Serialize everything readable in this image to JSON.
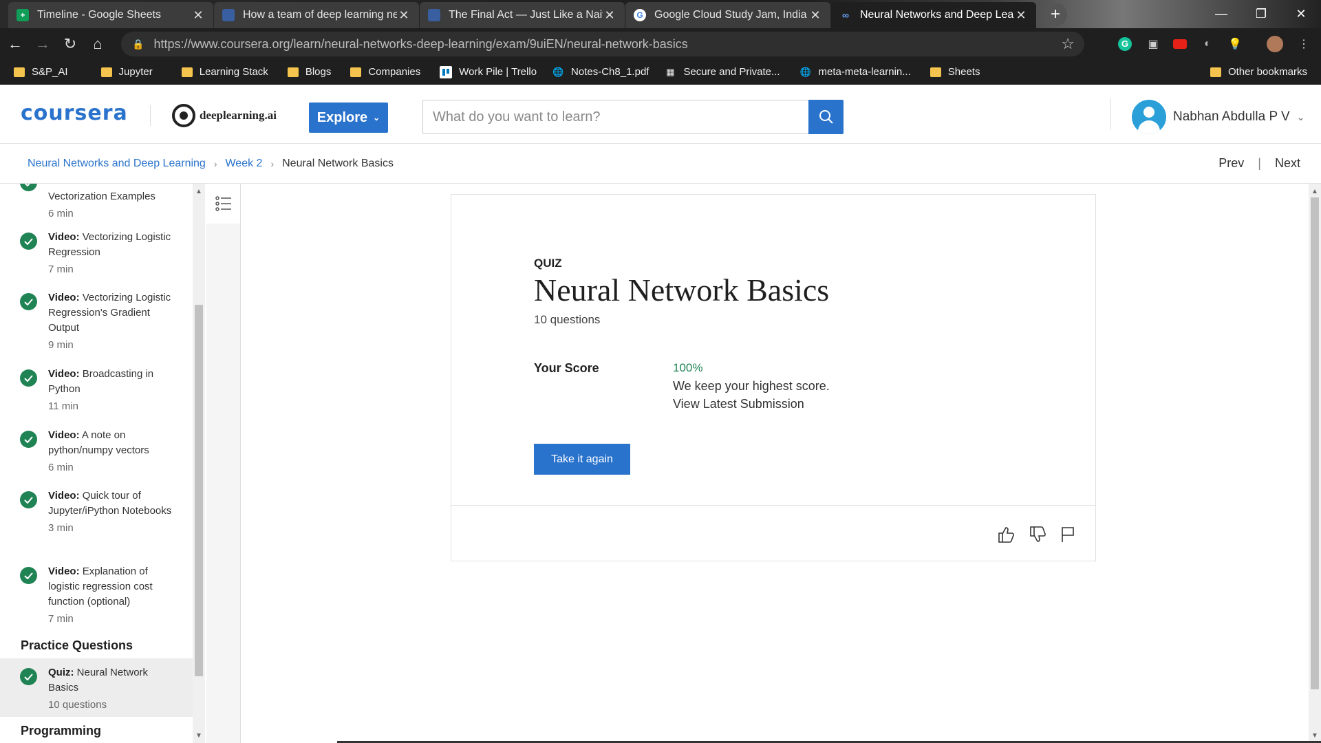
{
  "browser": {
    "tabs": [
      {
        "title": "Timeline - Google Sheets",
        "icon": "google-sheets-icon",
        "color": "#0f9d58"
      },
      {
        "title": "How a team of deep learning new",
        "icon": "page-icon",
        "color": "#3a5fa0"
      },
      {
        "title": "The Final Act — Just Like a Naive",
        "icon": "page-icon",
        "color": "#3a5fa0"
      },
      {
        "title": "Google Cloud Study Jam, India -",
        "icon": "google-icon",
        "color": "#4285f4"
      },
      {
        "title": "Neural Networks and Deep Learni",
        "icon": "coursera-icon",
        "color": "#2a73cc"
      }
    ],
    "url": "https://www.coursera.org/learn/neural-networks-deep-learning/exam/9uiEN/neural-network-basics",
    "bookmarks": [
      {
        "label": "S&P_AI",
        "type": "folder"
      },
      {
        "label": "Jupyter",
        "type": "folder"
      },
      {
        "label": "Learning Stack",
        "type": "folder"
      },
      {
        "label": "Blogs",
        "type": "folder"
      },
      {
        "label": "Companies",
        "type": "folder"
      },
      {
        "label": "Work Pile | Trello",
        "type": "trello"
      },
      {
        "label": "Notes-Ch8_1.pdf",
        "type": "globe"
      },
      {
        "label": "Secure and Private...",
        "type": "page"
      },
      {
        "label": "meta-meta-learnin...",
        "type": "globe"
      },
      {
        "label": "Sheets",
        "type": "folder"
      }
    ],
    "other_bookmarks": "Other bookmarks"
  },
  "header": {
    "logo": "coursera",
    "partner": "deeplearning.ai",
    "explore_label": "Explore",
    "search_placeholder": "What do you want to learn?",
    "user_name": "Nabhan Abdulla P V",
    "accent": "#2a73cc"
  },
  "breadcrumb": {
    "items": [
      "Neural Networks and Deep Learning",
      "Week 2"
    ],
    "current": "Neural Network Basics",
    "prev": "Prev",
    "next": "Next"
  },
  "sidebar": {
    "items": [
      {
        "kind": "",
        "title": "Vectorization Examples",
        "meta": "6 min"
      },
      {
        "kind": "Video:",
        "title": " Vectorizing Logistic Regression",
        "meta": "7 min"
      },
      {
        "kind": "Video:",
        "title": " Vectorizing Logistic Regression's Gradient Output",
        "meta": "9 min"
      },
      {
        "kind": "Video:",
        "title": " Broadcasting in Python",
        "meta": "11 min"
      },
      {
        "kind": "Video:",
        "title": " A note on python/numpy vectors",
        "meta": "6 min"
      },
      {
        "kind": "Video:",
        "title": " Quick tour of Jupyter/iPython Notebooks",
        "meta": "3 min"
      },
      {
        "kind": "Video:",
        "title": " Explanation of logistic regression cost function (optional)",
        "meta": "7 min"
      }
    ],
    "section_practice": "Practice Questions",
    "practice_item": {
      "kind": "Quiz:",
      "title": " Neural Network Basics",
      "meta": "10 questions"
    },
    "section_programming": "Programming"
  },
  "quiz": {
    "label": "QUIZ",
    "title": "Neural Network Basics",
    "question_count": "10 questions",
    "score_label": "Your Score",
    "score": "100%",
    "keep_note": "We keep your highest score.",
    "view_submission": "View Latest Submission",
    "take_again": "Take it again",
    "score_color": "#1f8354"
  }
}
